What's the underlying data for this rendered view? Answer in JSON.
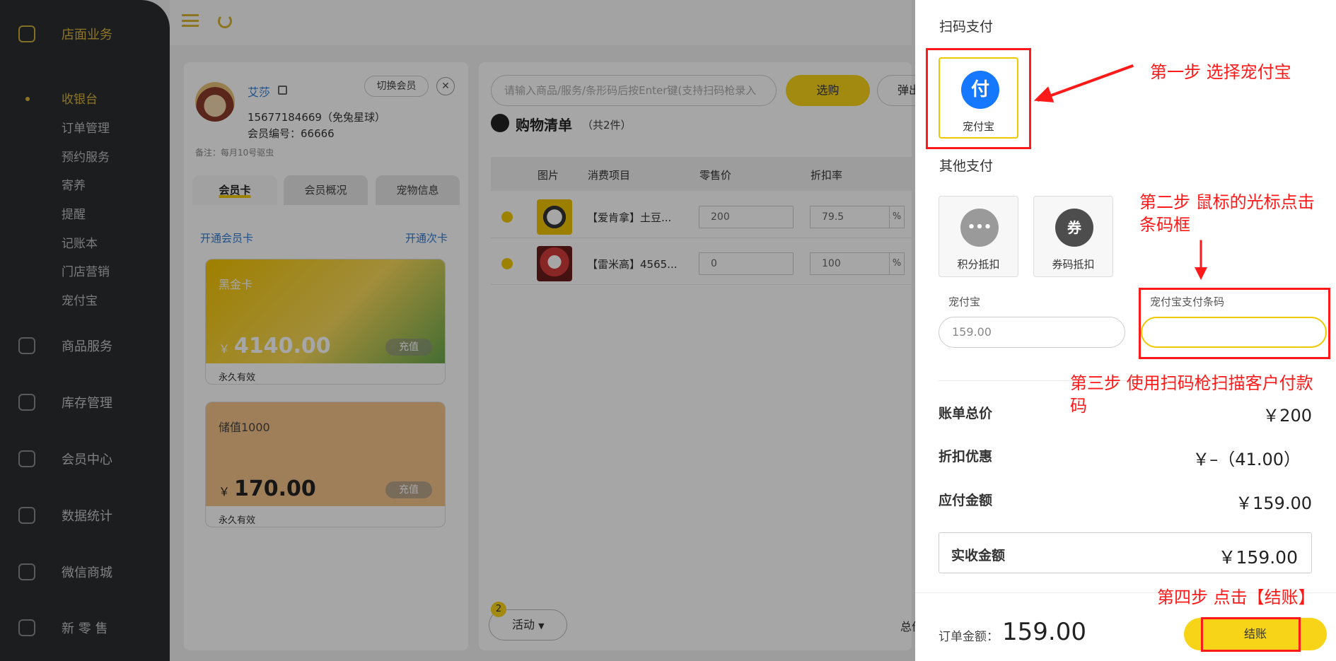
{
  "sidebar": {
    "groups": [
      {
        "label": "店面业务",
        "icon": "home-icon"
      },
      {
        "label": "商品服务",
        "icon": "bag-icon"
      },
      {
        "label": "库存管理",
        "icon": "archive-icon"
      },
      {
        "label": "会员中心",
        "icon": "member-icon"
      },
      {
        "label": "数据统计",
        "icon": "chart-icon"
      },
      {
        "label": "微信商城",
        "icon": "wechat-icon"
      },
      {
        "label": "新 零 售",
        "icon": "cube-icon"
      }
    ],
    "subitems": [
      "收银台",
      "订单管理",
      "预约服务",
      "寄养",
      "提醒",
      "记账本",
      "门店营销",
      "宠付宝"
    ]
  },
  "member": {
    "name": "艾莎",
    "switch_label": "切换会员",
    "close": "✕",
    "phone": "15677184669（免兔星球）",
    "number": "会员编号：66666",
    "note": "备注：每月10号驱虫",
    "tabs": [
      "会员卡",
      "会员概况",
      "宠物信息"
    ],
    "open_card": "开通会员卡",
    "open_times": "开通次卡",
    "cards": [
      {
        "name": "黑金卡",
        "currency": "￥",
        "amount": "4140.00",
        "recharge": "充值",
        "valid": "永久有效"
      },
      {
        "name": "储值1000",
        "currency": "￥",
        "amount": "170.00",
        "recharge": "充值",
        "valid": "永久有效"
      }
    ]
  },
  "main": {
    "search_placeholder": "请输入商品/服务/条形码后按Enter键(支持扫码枪录入",
    "select_label": "选购",
    "popup_label": "弹出",
    "cart_title": "购物清单",
    "cart_count": "（共2件）",
    "columns": [
      "图片",
      "消费项目",
      "零售价",
      "折扣率"
    ],
    "rows": [
      {
        "name": "【爱肯拿】土豆...",
        "price": "200",
        "discount": "79.5",
        "pct": "%"
      },
      {
        "name": "【雷米高】4565...",
        "price": "0",
        "discount": "100",
        "pct": "%"
      }
    ],
    "activity_badge": "2",
    "activity_label": "活动",
    "activity_caret": "▼",
    "total_trunc": "总价"
  },
  "payment": {
    "scan_title": "扫码支付",
    "scan_method": {
      "glyph": "付",
      "label": "宠付宝",
      "color": "#1677ff"
    },
    "other_title": "其他支付",
    "other_methods": [
      {
        "glyph": "•••",
        "label": "积分抵扣",
        "color": "#9a9a9a"
      },
      {
        "glyph": "券",
        "label": "券码抵扣",
        "color": "#4d4d4d"
      }
    ],
    "amount_label": "宠付宝",
    "amount_value": "159.00",
    "barcode_label": "宠付宝支付条码",
    "barcode_value": "",
    "bill_total_label": "账单总价",
    "bill_total_value": "￥200",
    "discount_label": "折扣优惠",
    "discount_value": "￥–（41.00）",
    "payable_label": "应付金额",
    "payable_value": "￥159.00",
    "received_label": "实收金额",
    "received_value": "￥159.00",
    "order_label": "订单金额：",
    "order_value": "159.00",
    "checkout_label": "结账"
  },
  "annotations": {
    "step1": "第一步  选择宠付宝",
    "step2": "第二步 鼠标的光标点击条码框",
    "step3": "第三步  使用扫码枪扫描客户付款码",
    "step4": "第四步 点击【结账】"
  },
  "colors": {
    "accent": "#f7d417",
    "sidebar": "#2c2d30",
    "annotation": "#ff1a1a",
    "link": "#2e7bd6"
  }
}
